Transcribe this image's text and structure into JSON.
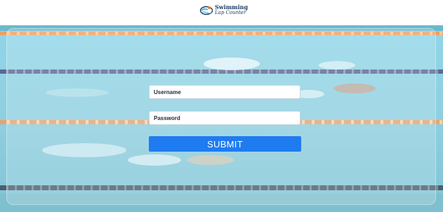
{
  "app": {
    "logo_line1": "Swimming",
    "logo_line2": "Lap Counter",
    "logo_icon": "swimmer-logo-icon"
  },
  "login": {
    "username_placeholder": "Username",
    "password_placeholder": "Password",
    "username_value": "",
    "password_value": "",
    "submit_label": "SUBMIT"
  },
  "colors": {
    "accent": "#1f7bf0",
    "water": "#8fd3e2",
    "brand_text": "#1f3d63"
  }
}
